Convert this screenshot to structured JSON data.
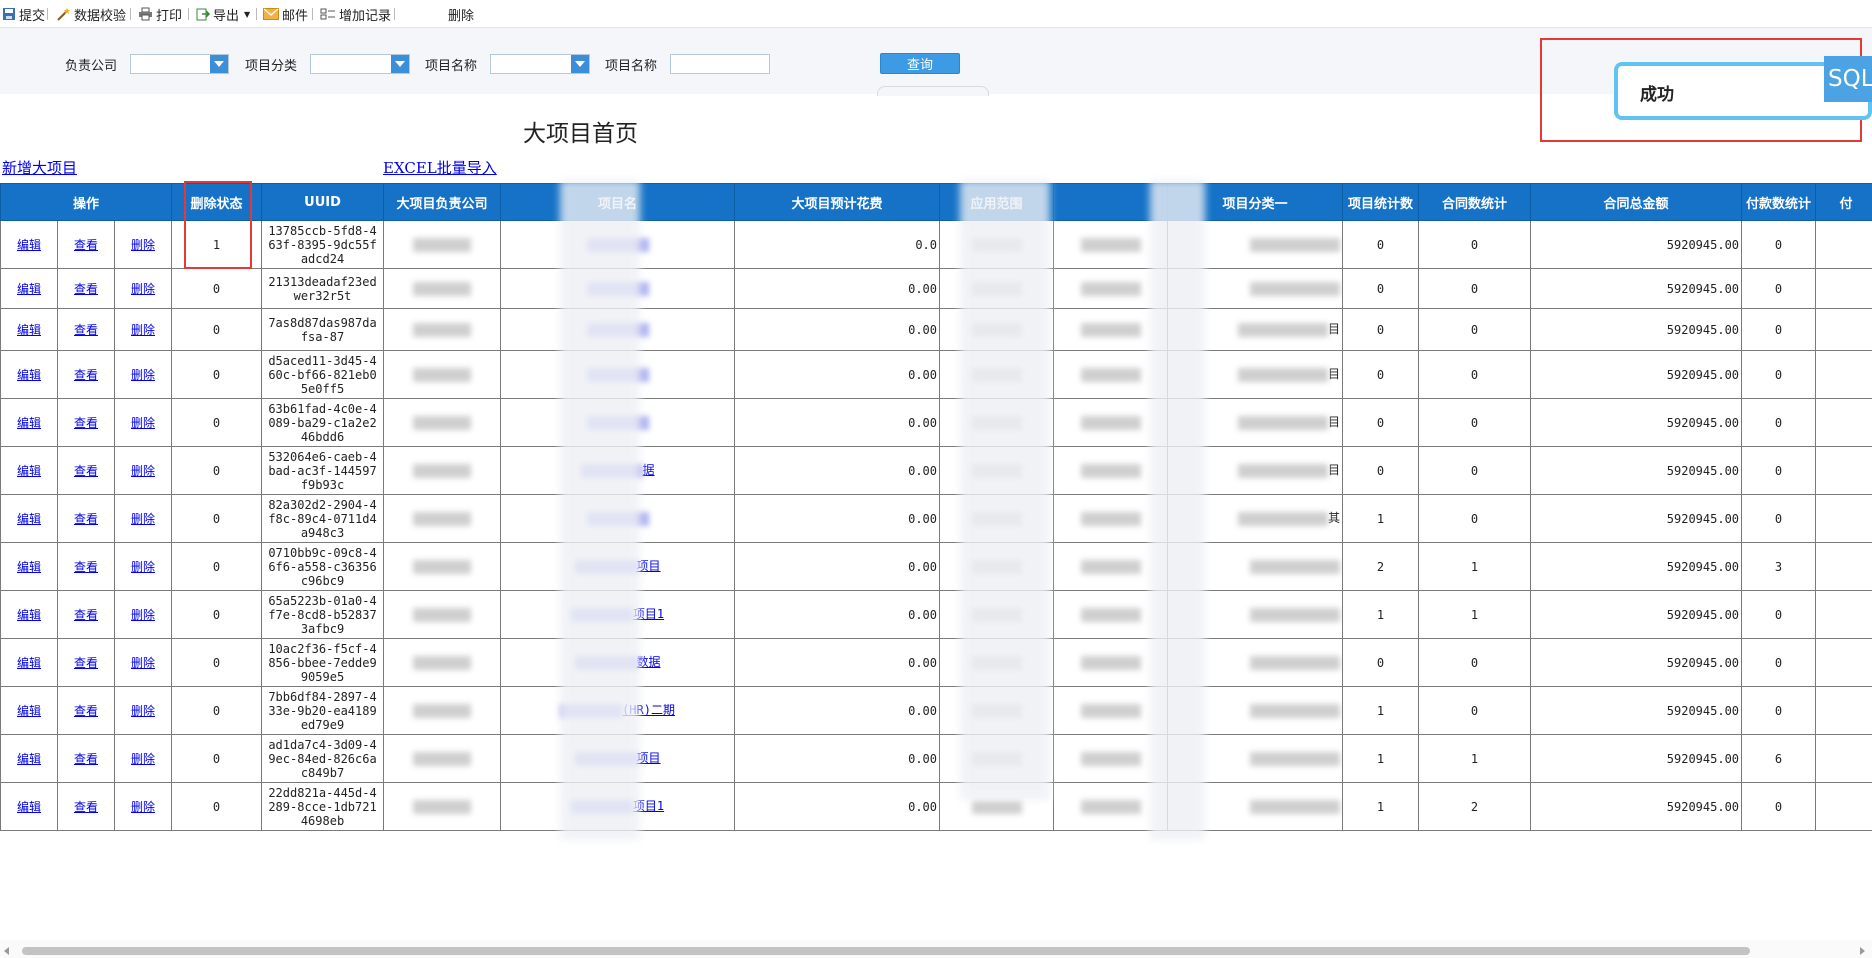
{
  "toolbar": {
    "submit": "提交",
    "validate": "数据校验",
    "print": "打印",
    "export": "导出",
    "mail": "邮件",
    "add_record": "增加记录",
    "delete": "删除"
  },
  "filters": {
    "company_label": "负责公司",
    "category_label": "项目分类",
    "name_label_1": "项目名称",
    "name_label_2": "项目名称",
    "query_button": "查询"
  },
  "toast": {
    "message": "成功",
    "badge": "SQL"
  },
  "page_title": "大项目首页",
  "links": {
    "add_new": "新增大项目",
    "excel_import": "EXCEL批量导入"
  },
  "table": {
    "headers": [
      "操作",
      "删除状态",
      "UUID",
      "大项目负责公司",
      "项目名",
      "大项目预计花费",
      "应用范围",
      "",
      "项目分类一",
      "项目统计数",
      "合同数统计",
      "合同总金额",
      "付款数统计",
      "付"
    ],
    "action_labels": {
      "edit": "编辑",
      "view": "查看",
      "delete": "删除"
    },
    "rows": [
      {
        "del": "1",
        "uuid": "13785ccb-5fd8-463f-8395-9dc55fadcd24",
        "name_tail": "",
        "cost": "0.0",
        "cat_tail": "",
        "stat": "0",
        "contracts": "0",
        "amount": "5920945.00",
        "pay": "0"
      },
      {
        "del": "0",
        "uuid": "21313deadaf23edwer32r5t",
        "name_tail": "",
        "cost": "0.00",
        "cat_tail": "",
        "stat": "0",
        "contracts": "0",
        "amount": "5920945.00",
        "pay": "0"
      },
      {
        "del": "0",
        "uuid": "7as8d87das987dafsa-87",
        "name_tail": "",
        "cost": "0.00",
        "cat_tail": "目",
        "stat": "0",
        "contracts": "0",
        "amount": "5920945.00",
        "pay": "0"
      },
      {
        "del": "0",
        "uuid": "d5aced11-3d45-460c-bf66-821eb05e0ff5",
        "name_tail": "",
        "cost": "0.00",
        "cat_tail": "目",
        "stat": "0",
        "contracts": "0",
        "amount": "5920945.00",
        "pay": "0"
      },
      {
        "del": "0",
        "uuid": "63b61fad-4c0e-4089-ba29-c1a2e246bdd6",
        "name_tail": "",
        "cost": "0.00",
        "cat_tail": "目",
        "stat": "0",
        "contracts": "0",
        "amount": "5920945.00",
        "pay": "0"
      },
      {
        "del": "0",
        "uuid": "532064e6-caeb-4bad-ac3f-144597f9b93c",
        "name_tail": "据",
        "cost": "0.00",
        "cat_tail": "目",
        "stat": "0",
        "contracts": "0",
        "amount": "5920945.00",
        "pay": "0"
      },
      {
        "del": "0",
        "uuid": "82a302d2-2904-4f8c-89c4-0711d4a948c3",
        "name_tail": "",
        "cost": "0.00",
        "cat_tail": "其",
        "stat": "1",
        "contracts": "0",
        "amount": "5920945.00",
        "pay": "0"
      },
      {
        "del": "0",
        "uuid": "0710bb9c-09c8-46f6-a558-c36356c96bc9",
        "name_tail": "项目",
        "cost": "0.00",
        "cat_tail": "",
        "stat": "2",
        "contracts": "1",
        "amount": "5920945.00",
        "pay": "3"
      },
      {
        "del": "0",
        "uuid": "65a5223b-01a0-4f7e-8cd8-b528373afbc9",
        "name_tail": "项目1",
        "cost": "0.00",
        "cat_tail": "",
        "stat": "1",
        "contracts": "1",
        "amount": "5920945.00",
        "pay": "0"
      },
      {
        "del": "0",
        "uuid": "10ac2f36-f5cf-4856-bbee-7edde99059e5",
        "name_tail": "数据",
        "cost": "0.00",
        "cat_tail": "",
        "stat": "0",
        "contracts": "0",
        "amount": "5920945.00",
        "pay": "0"
      },
      {
        "del": "0",
        "uuid": "7bb6df84-2897-433e-9b20-ea4189ed79e9",
        "name_tail": "(HR)二期",
        "cost": "0.00",
        "cat_tail": "",
        "stat": "1",
        "contracts": "0",
        "amount": "5920945.00",
        "pay": "0"
      },
      {
        "del": "0",
        "uuid": "ad1da7c4-3d09-49ec-84ed-826c6ac849b7",
        "name_tail": "项目",
        "cost": "0.00",
        "cat_tail": "",
        "stat": "1",
        "contracts": "1",
        "amount": "5920945.00",
        "pay": "6"
      },
      {
        "del": "0",
        "uuid": "22dd821a-445d-4289-8cce-1db7214698eb",
        "name_tail": "项目1",
        "cost": "0.00",
        "cat_tail": "",
        "stat": "1",
        "contracts": "2",
        "amount": "5920945.00",
        "pay": "0"
      }
    ]
  }
}
